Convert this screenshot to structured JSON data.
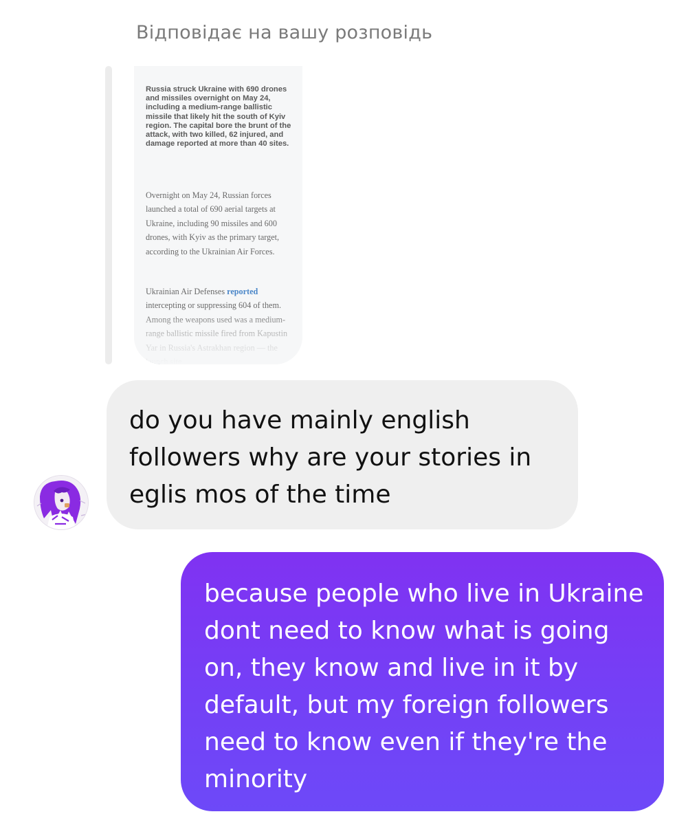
{
  "reply_context": {
    "header": "Відповідає на вашу розповідь"
  },
  "story_preview": {
    "lead": "Russia struck Ukraine with 690 drones and missiles overnight on May 24, including a medium-range ballistic missile that likely hit the south of Kyiv region. The capital bore the brunt of the attack, with two killed, 62 injured, and damage reported at more than 40 sites.",
    "paragraph1": "Overnight on May 24, Russian forces launched a total of 690 aerial targets at Ukraine, including 90 missiles and 600 drones, with Kyiv as the primary target, according to the Ukrainian Air Forces.",
    "paragraph2_before_link": "Ukrainian Air Defenses ",
    "paragraph2_link": "reported",
    "paragraph2_after_link": " intercepting or suppressing 604 of them. Among the weapons used was a medium-range ballistic missile fired from Kapustin Yar in Russia's Astrakhan region — the launch site"
  },
  "messages": {
    "incoming": {
      "text": "do you have mainly english followers why are your stories in eglis mos of the time"
    },
    "outgoing": {
      "text": "because people who live in Ukraine dont need to know what is going on, they know and live in it by default, but my foreign followers need to know even if they're the minority"
    }
  },
  "colors": {
    "incoming_bubble": "#efefef",
    "outgoing_bubble_top": "#8032f2",
    "outgoing_bubble_bottom": "#6d49f8",
    "link": "#4a86c8",
    "avatar_accent": "#8a2be2"
  },
  "icons": {
    "avatar": "user-avatar-purple-hair"
  }
}
